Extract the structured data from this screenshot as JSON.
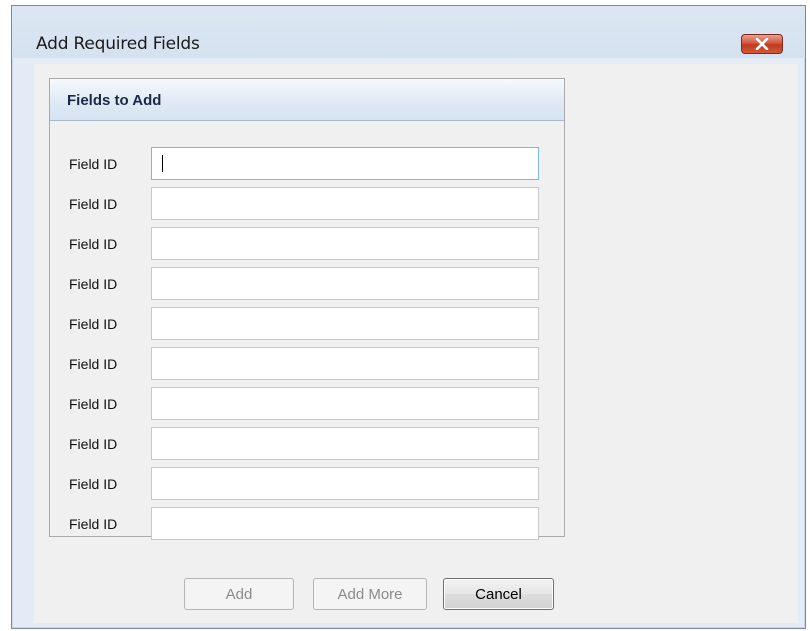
{
  "window": {
    "title": "Add Required Fields"
  },
  "icons": {
    "close": "close-icon"
  },
  "group": {
    "title": "Fields to Add",
    "rows": [
      {
        "label": "Field ID",
        "value": ""
      },
      {
        "label": "Field ID",
        "value": ""
      },
      {
        "label": "Field ID",
        "value": ""
      },
      {
        "label": "Field ID",
        "value": ""
      },
      {
        "label": "Field ID",
        "value": ""
      },
      {
        "label": "Field ID",
        "value": ""
      },
      {
        "label": "Field ID",
        "value": ""
      },
      {
        "label": "Field ID",
        "value": ""
      },
      {
        "label": "Field ID",
        "value": ""
      },
      {
        "label": "Field ID",
        "value": ""
      }
    ]
  },
  "buttons": {
    "add": "Add",
    "add_more": "Add More",
    "cancel": "Cancel"
  },
  "colors": {
    "window_frame": "#e3ecf6",
    "close_button": "#c9492c",
    "focus_border": "#7eb4ea"
  }
}
